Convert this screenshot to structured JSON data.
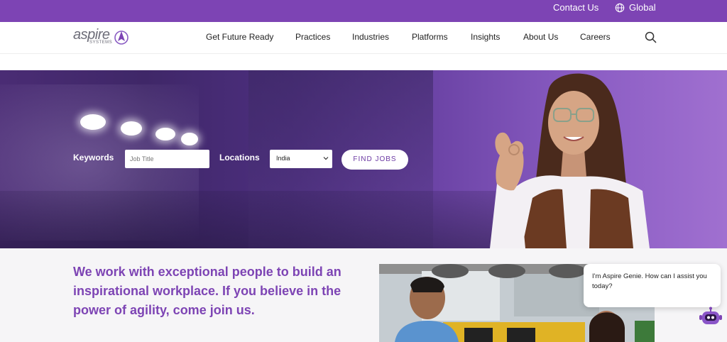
{
  "topbar": {
    "contact_label": "Contact Us",
    "global_label": "Global",
    "background": "#7d44b4"
  },
  "logo": {
    "word": "aspire",
    "sub": "SYSTEMS"
  },
  "nav": {
    "items": [
      {
        "label": "Get Future Ready"
      },
      {
        "label": "Practices"
      },
      {
        "label": "Industries"
      },
      {
        "label": "Platforms"
      },
      {
        "label": "Insights"
      },
      {
        "label": "About Us"
      },
      {
        "label": "Careers"
      }
    ],
    "search_icon": "search-icon"
  },
  "search_form": {
    "keywords_label": "Keywords",
    "keywords_placeholder": "Job Title",
    "locations_label": "Locations",
    "location_value": "India",
    "find_button": "FIND JOBS"
  },
  "content": {
    "headline": "We work with exceptional people to build an inspirational workplace. If you believe in the power of agility, come join us."
  },
  "chat": {
    "message": "I'm Aspire Genie. How can I assist you today?",
    "bot_icon": "robot-icon"
  },
  "colors": {
    "brand_purple": "#7d44b4",
    "headline_purple": "#7d44b4"
  }
}
